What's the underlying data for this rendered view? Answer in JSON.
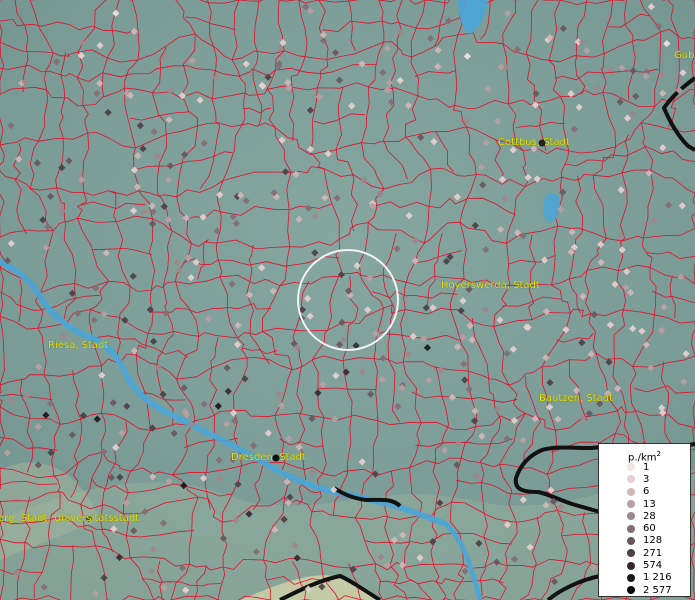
{
  "map": {
    "region": "Saxony / Brandenburg border area",
    "colors": {
      "terrain": "#7fa09b",
      "boundaries": "#e0102a",
      "rivers": "#4aa6d8",
      "country_border": "#111111",
      "labels": "#e5e600"
    },
    "cities": [
      {
        "name": "Cottbus, Stadt"
      },
      {
        "name": "Hoyerswerda, Stadt"
      },
      {
        "name": "Riesa, Stadt"
      },
      {
        "name": "Bautzen, Stadt"
      },
      {
        "name": "Dresden, Stadt"
      },
      {
        "name": "erg, Stadt, Universitätsstadt"
      },
      {
        "name": "Gub"
      }
    ],
    "legend": {
      "title": "p./km",
      "title_sup": "2",
      "items": [
        {
          "label": "1",
          "color": "#f3e3e3"
        },
        {
          "label": "3",
          "color": "#e6d0d0"
        },
        {
          "label": "6",
          "color": "#d1b7b9"
        },
        {
          "label": "13",
          "color": "#b9a0a4"
        },
        {
          "label": "28",
          "color": "#9e878c"
        },
        {
          "label": "60",
          "color": "#826e74"
        },
        {
          "label": "128",
          "color": "#67575d"
        },
        {
          "label": "271",
          "color": "#4b4045"
        },
        {
          "label": "574",
          "color": "#33292e"
        },
        {
          "label": "1 216",
          "color": "#1d1619"
        },
        {
          "label": "2 577",
          "color": "#050405"
        }
      ]
    }
  }
}
